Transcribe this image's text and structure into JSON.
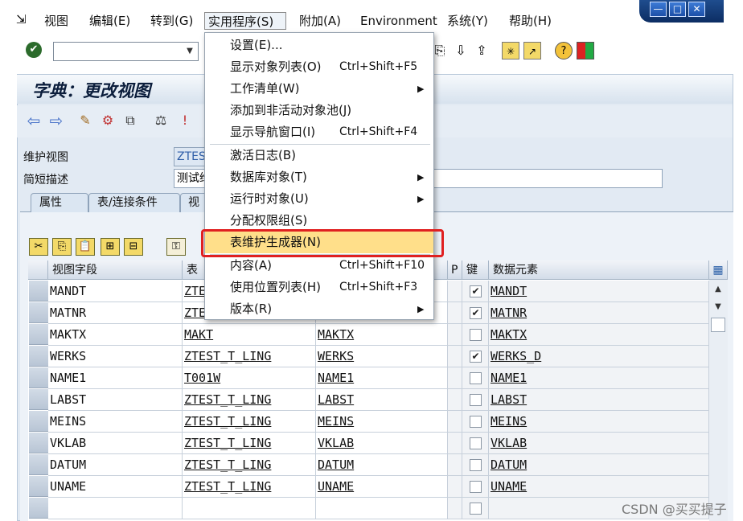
{
  "menubar": {
    "items": [
      "视图",
      "编辑(E)",
      "转到(G)",
      "实用程序(S)",
      "附加(A)",
      "Environment",
      "系统(Y)",
      "帮助(H)"
    ],
    "active_index": 3
  },
  "window_controls": {
    "minimize": "—",
    "maximize": "□",
    "close": "✕"
  },
  "command_field": {
    "value": ""
  },
  "page": {
    "title": "字典：更改视图"
  },
  "form": {
    "maintain_view_label": "维护视图",
    "maintain_view_value": "ZTES",
    "short_desc_label": "简短描述",
    "short_desc_value": "测试维"
  },
  "tabs": [
    {
      "label": "属性"
    },
    {
      "label": "表/连接条件"
    },
    {
      "label": "视"
    }
  ],
  "table": {
    "headers": [
      "视图字段",
      "表",
      "",
      "P",
      "键",
      "数据元素"
    ],
    "rows": [
      {
        "field": "MANDT",
        "table": "ZTE",
        "tfield": "",
        "key": true,
        "element": "MANDT"
      },
      {
        "field": "MATNR",
        "table": "ZTE",
        "tfield": "",
        "key": true,
        "element": "MATNR"
      },
      {
        "field": "MAKTX",
        "table": "MAKT",
        "tfield": "MAKTX",
        "key": false,
        "element": "MAKTX"
      },
      {
        "field": "WERKS",
        "table": "ZTEST_T_LING",
        "tfield": "WERKS",
        "key": true,
        "element": "WERKS_D"
      },
      {
        "field": "NAME1",
        "table": "T001W",
        "tfield": "NAME1",
        "key": false,
        "element": "NAME1"
      },
      {
        "field": "LABST",
        "table": "ZTEST_T_LING",
        "tfield": "LABST",
        "key": false,
        "element": "LABST"
      },
      {
        "field": "MEINS",
        "table": "ZTEST_T_LING",
        "tfield": "MEINS",
        "key": false,
        "element": "MEINS"
      },
      {
        "field": "VKLAB",
        "table": "ZTEST_T_LING",
        "tfield": "VKLAB",
        "key": false,
        "element": "VKLAB"
      },
      {
        "field": "DATUM",
        "table": "ZTEST_T_LING",
        "tfield": "DATUM",
        "key": false,
        "element": "DATUM"
      },
      {
        "field": "UNAME",
        "table": "ZTEST_T_LING",
        "tfield": "UNAME",
        "key": false,
        "element": "UNAME"
      },
      {
        "field": "",
        "table": "",
        "tfield": "",
        "key": false,
        "element": ""
      }
    ]
  },
  "dropdown": {
    "items": [
      {
        "label": "设置(E)...",
        "shortcut": "",
        "submenu": false
      },
      {
        "label": "显示对象列表(O)",
        "shortcut": "Ctrl+Shift+F5",
        "submenu": false
      },
      {
        "label": "工作清单(W)",
        "shortcut": "",
        "submenu": true
      },
      {
        "label": "添加到非活动对象池(J)",
        "shortcut": "",
        "submenu": false
      },
      {
        "label": "显示导航窗口(I)",
        "shortcut": "Ctrl+Shift+F4",
        "submenu": false
      },
      {
        "label": "激活日志(B)",
        "shortcut": "",
        "submenu": false
      },
      {
        "label": "数据库对象(T)",
        "shortcut": "",
        "submenu": true
      },
      {
        "label": "运行时对象(U)",
        "shortcut": "",
        "submenu": true
      },
      {
        "label": "分配权限组(S)",
        "shortcut": "",
        "submenu": false
      },
      {
        "label": "表维护生成器(N)",
        "shortcut": "",
        "submenu": false
      },
      {
        "label": "内容(A)",
        "shortcut": "Ctrl+Shift+F10",
        "submenu": false
      },
      {
        "label": "使用位置列表(H)",
        "shortcut": "Ctrl+Shift+F3",
        "submenu": false
      },
      {
        "label": "版本(R)",
        "shortcut": "",
        "submenu": true
      }
    ],
    "separators_after": [
      4,
      9
    ],
    "highlighted_index": 9,
    "submenu_arrow": "▶"
  },
  "watermark": "CSDN @买买提子",
  "colors": {
    "highlight": "#ffdf8a",
    "annotation_box": "#e02020"
  }
}
